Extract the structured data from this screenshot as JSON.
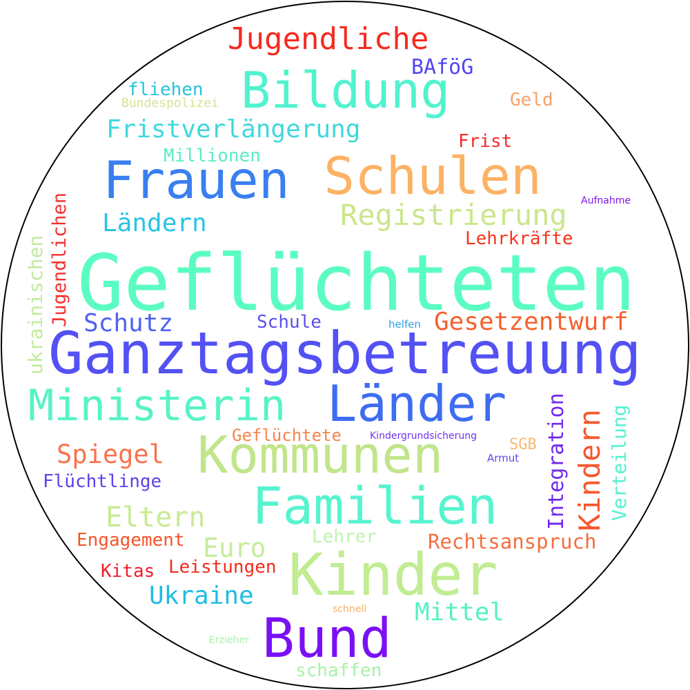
{
  "words": [
    {
      "text": "Geflüchteten",
      "color": "#5bfcc2"
    },
    {
      "text": "Ganztagsbetreuung",
      "color": "#5351f4"
    },
    {
      "text": "Kinder",
      "color": "#c1ec92"
    },
    {
      "text": "Kommunen",
      "color": "#c1e58b"
    },
    {
      "text": "Familien",
      "color": "#56f4cf"
    },
    {
      "text": "Schulen",
      "color": "#fcb265"
    },
    {
      "text": "Frauen",
      "color": "#3a7ff0"
    },
    {
      "text": "Bildung",
      "color": "#51f3ce"
    },
    {
      "text": "Länder",
      "color": "#3d6df0"
    },
    {
      "text": "Ministerin",
      "color": "#57f3c6"
    },
    {
      "text": "Bund",
      "color": "#7a10f5"
    },
    {
      "text": "Jugendliche",
      "color": "#f52a20"
    },
    {
      "text": "Registrierung",
      "color": "#cbe68c"
    },
    {
      "text": "Gesetzentwurf",
      "color": "#f5612e"
    },
    {
      "text": "Fristverlängerung",
      "color": "#3fd8dc"
    },
    {
      "text": "Ländern",
      "color": "#28c4e3"
    },
    {
      "text": "Schutz",
      "color": "#4e61f1"
    },
    {
      "text": "Spiegel",
      "color": "#f8734c"
    },
    {
      "text": "Eltern",
      "color": "#c9ea92"
    },
    {
      "text": "Ukraine",
      "color": "#1fbde3"
    },
    {
      "text": "Mittel",
      "color": "#58f0c3"
    },
    {
      "text": "Euro",
      "color": "#c5ed9c"
    },
    {
      "text": "Rechtsanspruch",
      "color": "#f56e3f"
    },
    {
      "text": "Kindern",
      "color": "#f6572e"
    },
    {
      "text": "Integration",
      "color": "#7028ee"
    },
    {
      "text": "Verteilung",
      "color": "#56f0d2"
    },
    {
      "text": "Jugendlichen",
      "color": "#f52f2f"
    },
    {
      "text": "ukrainischen",
      "color": "#c2eb9e"
    },
    {
      "text": "Millionen",
      "color": "#59ecc6"
    },
    {
      "text": "fliehen",
      "color": "#25c4dc"
    },
    {
      "text": "BAföG",
      "color": "#5146ee"
    },
    {
      "text": "Geld",
      "color": "#f7a269"
    },
    {
      "text": "Frist",
      "color": "#f52929"
    },
    {
      "text": "Lehrkräfte",
      "color": "#f5351d"
    },
    {
      "text": "Bundespolizei",
      "color": "#d4e394"
    },
    {
      "text": "Schule",
      "color": "#5a50ec"
    },
    {
      "text": "Flüchtlinge",
      "color": "#5e40ea"
    },
    {
      "text": "Geflüchtete",
      "color": "#f7844c"
    },
    {
      "text": "Engagement",
      "color": "#f6542c"
    },
    {
      "text": "Kitas",
      "color": "#f01c2c"
    },
    {
      "text": "Leistungen",
      "color": "#f32c1a"
    },
    {
      "text": "Lehrer",
      "color": "#c0f4ad"
    },
    {
      "text": "SGB",
      "color": "#fbb770"
    },
    {
      "text": "schaffen",
      "color": "#a8f2a6"
    },
    {
      "text": "Kindergrundsicherung",
      "color": "#7032ee"
    },
    {
      "text": "Aufnahme",
      "color": "#7c14ee"
    },
    {
      "text": "helfen",
      "color": "#2a9fe2"
    },
    {
      "text": "Armut",
      "color": "#5a4aea"
    },
    {
      "text": "schnell",
      "color": "#fbad66"
    },
    {
      "text": "Erzieher",
      "color": "#a6f2a8"
    }
  ]
}
